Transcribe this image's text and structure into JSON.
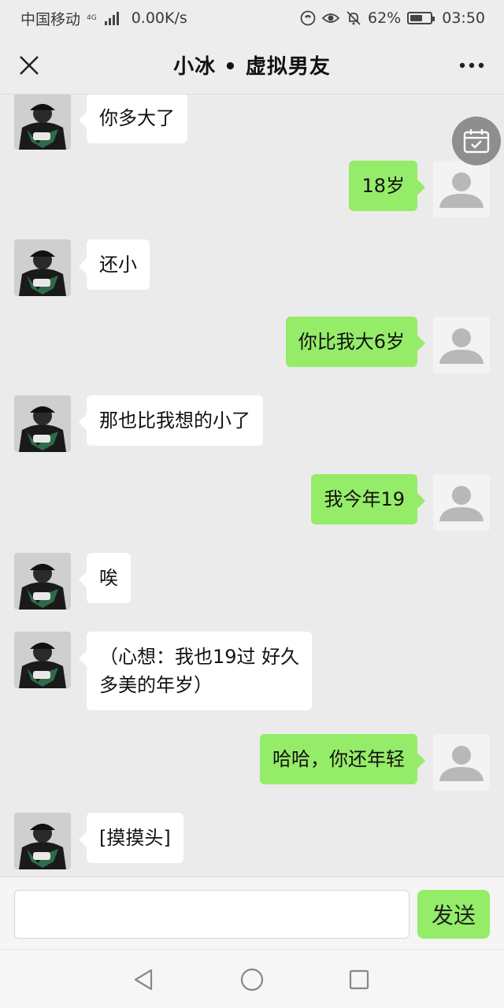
{
  "status_bar": {
    "carrier": "中国移动",
    "network_type": "4G",
    "speed": "0.00K/s",
    "battery": "62%",
    "battery_level": 0.62,
    "time": "03:50",
    "icons": [
      "hd-call-icon",
      "eye-icon",
      "mute-bell-icon",
      "battery-icon"
    ]
  },
  "title_bar": {
    "title": "小冰 • 虚拟男友",
    "close_icon": "close-icon",
    "more_icon": "more-dots-icon"
  },
  "chat": {
    "messages": [
      {
        "side": "left",
        "text": "你多大了"
      },
      {
        "side": "right",
        "text": "18岁"
      },
      {
        "side": "left",
        "text": "还小"
      },
      {
        "side": "right",
        "text": "你比我大6岁"
      },
      {
        "side": "left",
        "text": "那也比我想的小了"
      },
      {
        "side": "right",
        "text": "我今年19"
      },
      {
        "side": "left",
        "text": "唉"
      },
      {
        "side": "left",
        "text": "（心想：我也19过 好久\n多美的年岁）"
      },
      {
        "side": "right",
        "text": "哈哈，你还年轻"
      },
      {
        "side": "left",
        "text": "[摸摸头]"
      }
    ],
    "floating_icon": "calendar-icon"
  },
  "input_bar": {
    "value": "",
    "placeholder": "",
    "send_label": "发送"
  },
  "nav_bar": {
    "icons": [
      "back-triangle-icon",
      "home-circle-icon",
      "recents-square-icon"
    ]
  },
  "colors": {
    "accent_green": "#95ec69",
    "chat_bg": "#ebebeb",
    "bubble_left": "#ffffff"
  }
}
